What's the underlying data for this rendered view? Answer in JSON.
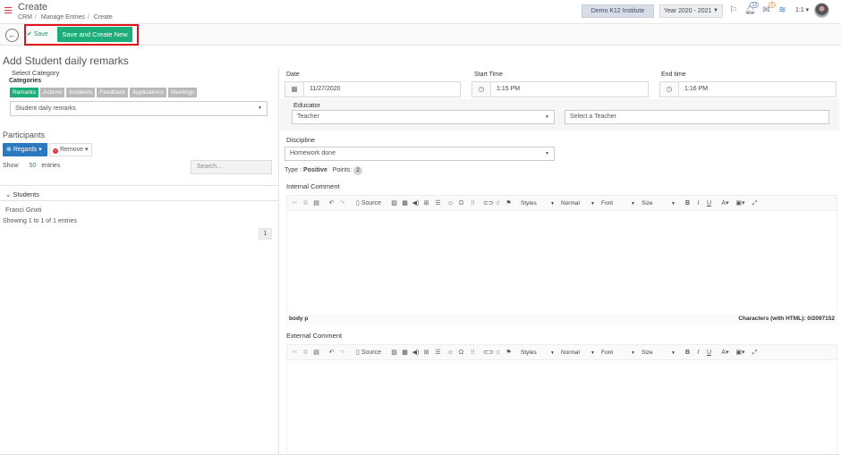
{
  "header": {
    "title": "Create",
    "breadcrumb": [
      "CRM",
      "Manage Entries",
      "Create"
    ],
    "institute": "Demo K12 Institute",
    "year": "Year 2020 - 2021",
    "notifications_count": "12",
    "messages_count": "0",
    "user_label": "1:1"
  },
  "actions": {
    "save_label": "Save",
    "save_new_label": "Save and Create New"
  },
  "form": {
    "title": "Add Student daily remarks",
    "select_category_label": "Select Category",
    "categories_label": "Categories",
    "category_tabs": [
      "Remarks",
      "Actions",
      "Incidents",
      "Feedback",
      "Applications",
      "Meetings"
    ],
    "category_value": "Student daily remarks"
  },
  "participants": {
    "label": "Participants",
    "regards_label": "Regards",
    "remove_label": "Remove",
    "show_label": "Show",
    "show_value": "50",
    "entries_label": "entries",
    "search_placeholder": "Search...",
    "group_label": "Students",
    "rows": [
      "Franci Grixti"
    ],
    "info": "Showing 1 to 1 of 1 entries",
    "page": "1"
  },
  "details": {
    "date_label": "Date",
    "date_value": "11/27/2020",
    "start_label": "Start Time",
    "start_value": "1:15 PM",
    "end_label": "End time",
    "end_value": "1:16 PM",
    "educator_label": "Educator",
    "educator_type": "Teacher",
    "teacher_placeholder": "Select a Teacher",
    "discipline_label": "Discipline",
    "discipline_value": "Homework done",
    "type_label": "Type :",
    "type_value": "Positive",
    "points_label": "Points:",
    "points_value": "2"
  },
  "editor": {
    "internal_label": "Internal Comment",
    "external_label": "External Comment",
    "source_label": "Source",
    "styles_label": "Styles",
    "format_label": "Normal",
    "font_label": "Font",
    "size_label": "Size",
    "path_label": "body  p",
    "chars_label": "Characters (with HTML): 0/2097152"
  },
  "colors": {
    "accent_green": "#1cae78",
    "accent_blue": "#2a78c0",
    "highlight_red": "#e0121e"
  }
}
